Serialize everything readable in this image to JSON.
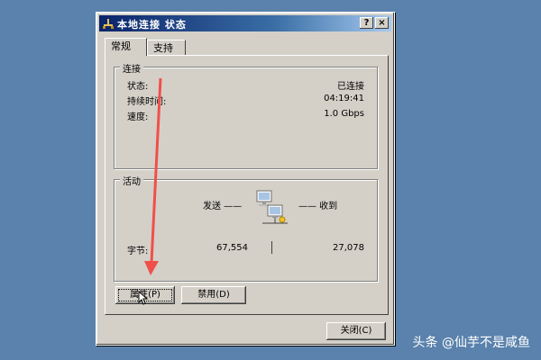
{
  "dialog": {
    "title": "本地连接 状态",
    "help_label": "?",
    "close_label": "×"
  },
  "tabs": [
    {
      "label": "常规"
    },
    {
      "label": "支持"
    }
  ],
  "connection": {
    "group_title": "连接",
    "status_label": "状态:",
    "status_value": "已连接",
    "duration_label": "持续时间:",
    "duration_value": "04:19:41",
    "speed_label": "速度:",
    "speed_value": "1.0 Gbps"
  },
  "activity": {
    "group_title": "活动",
    "sent_label": "发送 ——",
    "received_label": "—— 收到",
    "bytes_label": "字节:",
    "bytes_sent": "67,554",
    "bytes_received": "27,078"
  },
  "buttons": {
    "properties": "属性(P)",
    "disable": "禁用(D)",
    "close": "关闭(C)"
  },
  "watermark": "头条 @仙芋不是咸鱼",
  "colors": {
    "desktop": "#5a82ac",
    "title_bar": "#0a246a",
    "face": "#d4d0c8",
    "annotation_arrow": "#f0504a"
  }
}
